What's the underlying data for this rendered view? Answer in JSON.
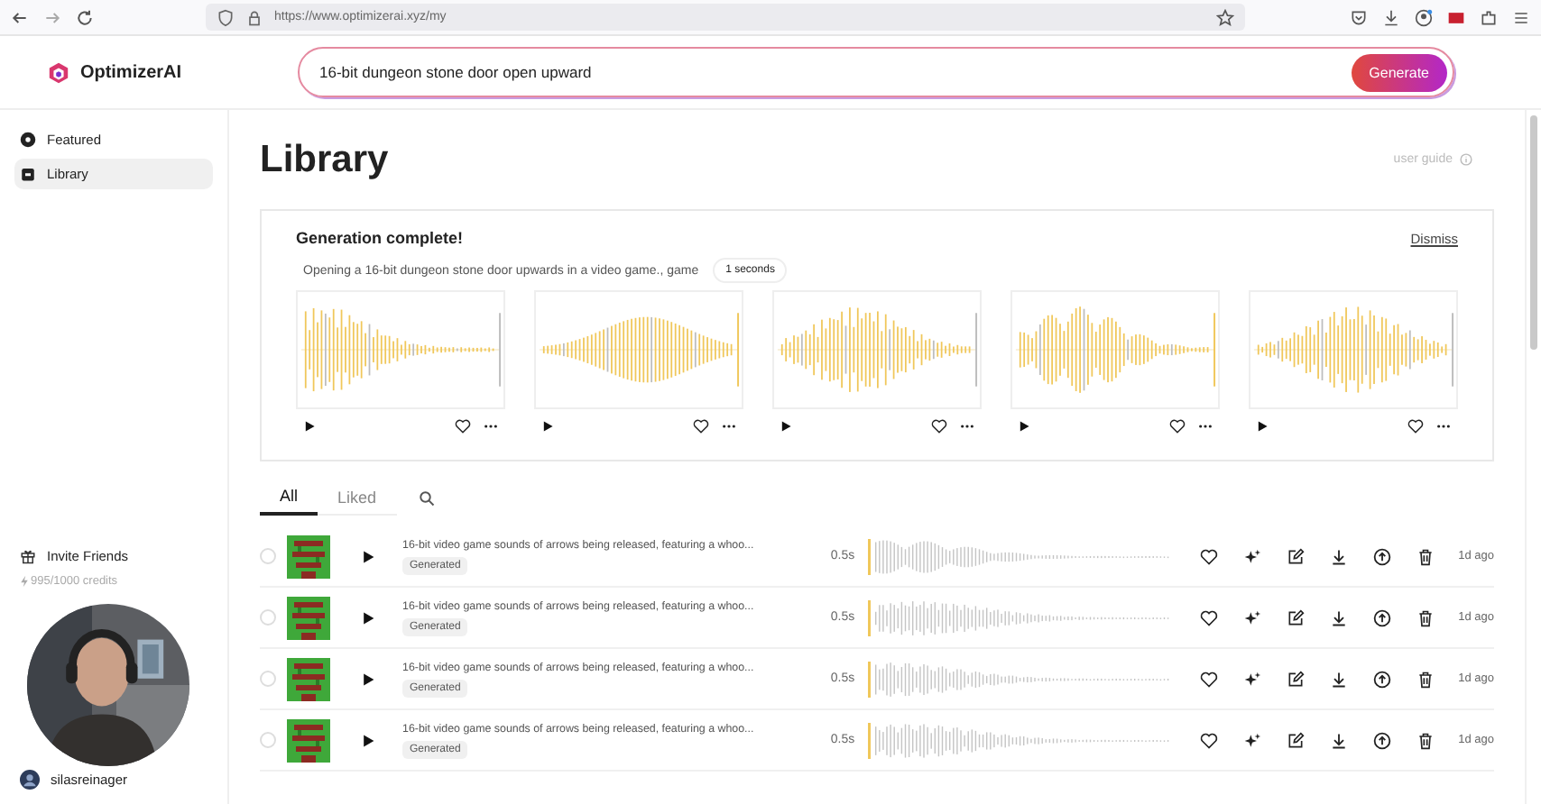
{
  "browser": {
    "url": "https://www.optimizerai.xyz/my"
  },
  "brand": "OptimizerAI",
  "prompt": {
    "value": "16-bit dungeon stone door open upward",
    "button": "Generate"
  },
  "sidebar": {
    "items": [
      {
        "label": "Featured",
        "selected": false
      },
      {
        "label": "Library",
        "selected": true
      }
    ],
    "invite": "Invite Friends",
    "credits": "995/1000 credits",
    "user": "silasreinager"
  },
  "page": {
    "title": "Library",
    "guide": "user guide"
  },
  "generation": {
    "title": "Generation complete!",
    "dismiss": "Dismiss",
    "prompt": "Opening a 16-bit dungeon stone door upwards in a video game., game",
    "duration": "1 seconds",
    "clips": [
      {
        "liked": false
      },
      {
        "liked": false
      },
      {
        "liked": false
      },
      {
        "liked": false
      },
      {
        "liked": false
      }
    ]
  },
  "tabs": [
    {
      "label": "All",
      "selected": true
    },
    {
      "label": "Liked",
      "selected": false
    }
  ],
  "rows": [
    {
      "title": "16-bit video game sounds of arrows being released, featuring a whoo...",
      "tag": "Generated",
      "duration": "0.5s",
      "age": "1d ago",
      "selected": false,
      "liked": false
    },
    {
      "title": "16-bit video game sounds of arrows being released, featuring a whoo...",
      "tag": "Generated",
      "duration": "0.5s",
      "age": "1d ago",
      "selected": false,
      "liked": false
    },
    {
      "title": "16-bit video game sounds of arrows being released, featuring a whoo...",
      "tag": "Generated",
      "duration": "0.5s",
      "age": "1d ago",
      "selected": false,
      "liked": false
    },
    {
      "title": "16-bit video game sounds of arrows being released, featuring a whoo...",
      "tag": "Generated",
      "duration": "0.5s",
      "age": "1d ago",
      "selected": false,
      "liked": false
    }
  ]
}
